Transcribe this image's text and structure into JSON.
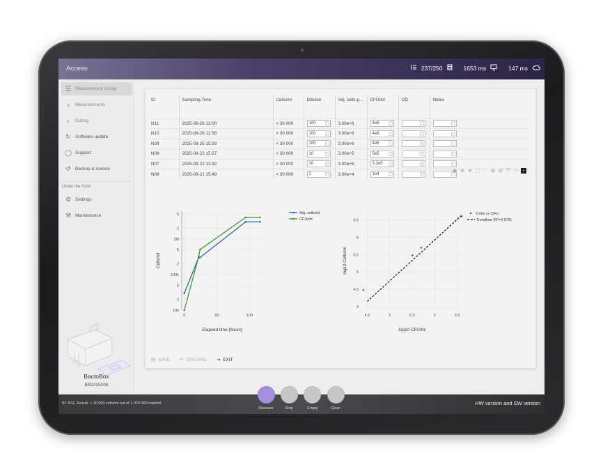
{
  "topbar": {
    "title": "Access",
    "storage": "237/250",
    "latency_device": "1653 ms",
    "latency_cloud": "147 ms"
  },
  "sidebar": {
    "items": [
      {
        "label": "Measurement Group",
        "icon": "list-icon"
      },
      {
        "label": "Measurements",
        "icon": "menu-icon"
      },
      {
        "label": "Gating",
        "icon": "gating-icon"
      },
      {
        "label": "Software update",
        "icon": "update-icon"
      },
      {
        "label": "Support",
        "icon": "chat-icon"
      },
      {
        "label": "Backup & restore",
        "icon": "restore-icon"
      }
    ],
    "section_label": "Under the hood",
    "hood_items": [
      {
        "label": "Settings",
        "icon": "gear-icon"
      },
      {
        "label": "Maintenance",
        "icon": "wrench-icon"
      }
    ],
    "device_name": "BactoBox",
    "device_id": "BB2425006"
  },
  "table": {
    "headers": [
      "ID",
      "Sampling Time",
      "Cells/ml",
      "Dilution",
      "Adj. cells p...",
      "CFU/ml",
      "OD",
      "Notes"
    ],
    "rows": [
      {
        "id": "N11",
        "time": "2025-08-26 13:00",
        "cells": "< 30 000",
        "dilution": "100",
        "adj": "3.00e+6",
        "cfu": "4e6"
      },
      {
        "id": "N10",
        "time": "2025-08-26 12:56",
        "cells": "< 30 000",
        "dilution": "100",
        "adj": "3.00e+6",
        "cfu": "4e6"
      },
      {
        "id": "N09",
        "time": "2025-08-25 15:39",
        "cells": "< 30 000",
        "dilution": "100",
        "adj": "3.00e+6",
        "cfu": "4e6"
      },
      {
        "id": "N08",
        "time": "2025-08-22 15:27",
        "cells": "< 30 000",
        "dilution": "10",
        "adj": "3.00e+5",
        "cfu": "5e5"
      },
      {
        "id": "N07",
        "time": "2025-08-22 13:32",
        "cells": "< 30 000",
        "dilution": "10",
        "adj": "3.00e+5",
        "cfu": "3.2e5"
      },
      {
        "id": "N06",
        "time": "2025-08-21 15:49",
        "cells": "< 30 000",
        "dilution": "1",
        "adj": "3.00e+4",
        "cfu": "1e4"
      }
    ]
  },
  "actions": {
    "save": "SAVE",
    "discard": "DISCARD",
    "exit": "EXIT"
  },
  "bottom": {
    "message": "ID: N11. Result: < 30 000 cells/ml out of 1 020 000 total/ml.",
    "version": "HW version and SW version",
    "buttons": [
      "Measure",
      "Stop",
      "Empty",
      "Clean"
    ]
  },
  "colors": {
    "adj_series": "#3b5aa8",
    "cfu_series": "#3a9a3a",
    "accent": "#a98ee0"
  },
  "chart_data": [
    {
      "type": "line",
      "xlabel": "Elapsed time [hours]",
      "ylabel": "Cells/ml",
      "yscale": "log",
      "xlim": [
        -4,
        122
      ],
      "xticks": [
        0,
        50,
        100
      ],
      "ytick_labels": [
        "10k",
        "2",
        "5",
        "100k",
        "2",
        "5",
        "1M",
        "2",
        "5"
      ],
      "ytick_values": [
        10000,
        20000,
        50000,
        100000,
        200000,
        500000,
        1000000,
        2000000,
        5000000
      ],
      "ylim": [
        10000,
        6000000
      ],
      "legend": "top-right",
      "series": [
        {
          "name": "Adj. cells/ml",
          "x": [
            0,
            22,
            24,
            94,
            116
          ],
          "y": [
            30000,
            300000,
            300000,
            3000000,
            3000000
          ]
        },
        {
          "name": "CFU/ml",
          "x": [
            0,
            22,
            24,
            94,
            116
          ],
          "y": [
            10000,
            320000,
            500000,
            4000000,
            4000000
          ]
        }
      ]
    },
    {
      "type": "scatter",
      "xlabel": "log10 CFU/ml",
      "ylabel": "log10 Cells/ml",
      "xlim": [
        4.4,
        6.6
      ],
      "ylim": [
        3.9,
        6.75
      ],
      "xticks": [
        4.5,
        5,
        5.5,
        6,
        6.5
      ],
      "yticks": [
        4,
        4.5,
        5,
        5.5,
        6,
        6.5
      ],
      "legend": "top-right",
      "series": [
        {
          "name": "Cells vs CFU",
          "x": [
            4.0,
            5.505,
            5.699,
            6.602
          ],
          "y": [
            4.477,
            5.477,
            5.699,
            6.602
          ]
        },
        {
          "name": "Trendline (R²=0.976)",
          "x": [
            4.5,
            6.6
          ],
          "y": [
            4.15,
            6.63
          ]
        }
      ]
    }
  ]
}
